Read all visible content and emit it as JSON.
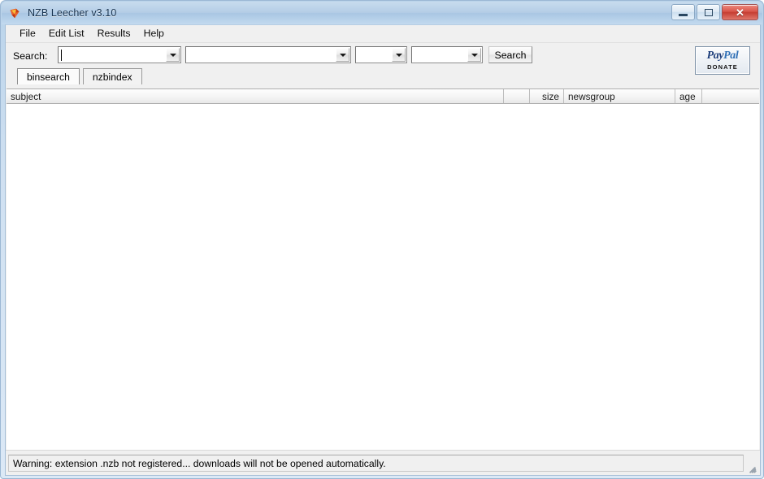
{
  "window": {
    "title": "NZB Leecher v3.10",
    "icon": "app-icon",
    "controls": {
      "minimize": "minimize-button",
      "maximize": "maximize-button",
      "close_glyph": "✕"
    }
  },
  "menubar": {
    "items": [
      {
        "label": "File"
      },
      {
        "label": "Edit List"
      },
      {
        "label": "Results"
      },
      {
        "label": "Help"
      }
    ]
  },
  "toolbar": {
    "search_label": "Search:",
    "search_button": "Search",
    "combos": [
      {
        "name": "search-query-combo",
        "value": "",
        "placeholder": ""
      },
      {
        "name": "category-combo",
        "value": "",
        "placeholder": ""
      },
      {
        "name": "age-combo",
        "value": "",
        "placeholder": ""
      },
      {
        "name": "group-combo",
        "value": "",
        "placeholder": ""
      }
    ],
    "donate": {
      "brand_pay": "Pay",
      "brand_pal": "Pal",
      "caption": "DONATE"
    }
  },
  "tabs": [
    {
      "label": "binsearch",
      "active": true
    },
    {
      "label": "nzbindex",
      "active": false
    }
  ],
  "results": {
    "columns": [
      {
        "label": "subject",
        "align": "left"
      },
      {
        "label": "",
        "align": "left"
      },
      {
        "label": "size",
        "align": "right"
      },
      {
        "label": "newsgroup",
        "align": "left"
      },
      {
        "label": "age",
        "align": "left"
      },
      {
        "label": "",
        "align": "left"
      }
    ],
    "rows": []
  },
  "statusbar": {
    "message": "Warning: extension .nzb not registered... downloads will not be opened automatically."
  },
  "colors": {
    "frame": "#b9d3ea",
    "title_text": "#16324f",
    "client_bg": "#f0f0f0",
    "list_bg": "#ffffff",
    "close_button": "#c63d32",
    "paypal_blue": "#1c3d7a"
  }
}
